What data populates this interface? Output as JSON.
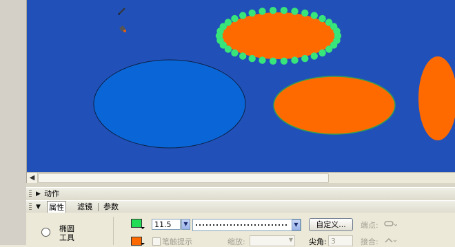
{
  "colors": {
    "stage_bg": "#2151b8",
    "ellipse_blue": "#0a66d6",
    "ellipse_orange": "#ff6a00",
    "dot_green": "#38e57a",
    "stroke_swatch": "#22dd55",
    "fill_swatch": "#ff6a00"
  },
  "icons": {
    "scroll_left": "arrow-left-icon",
    "pencil": "pencil-icon",
    "bucket": "paint-bucket-icon"
  },
  "panels": {
    "actions_label": "动作",
    "tabs": [
      "属性",
      "滤镜",
      "参数"
    ]
  },
  "tool": {
    "name_line1": "椭圆",
    "name_line2": "工具"
  },
  "stroke": {
    "height_value": "11.5",
    "custom_button": "自定义...",
    "endpoint_label": "端点:"
  },
  "fill": {
    "hint_label": "笔触提示",
    "scale_label": "缩放:",
    "corner_label": "尖角:",
    "corner_value": "3",
    "join_label": "接合:"
  }
}
